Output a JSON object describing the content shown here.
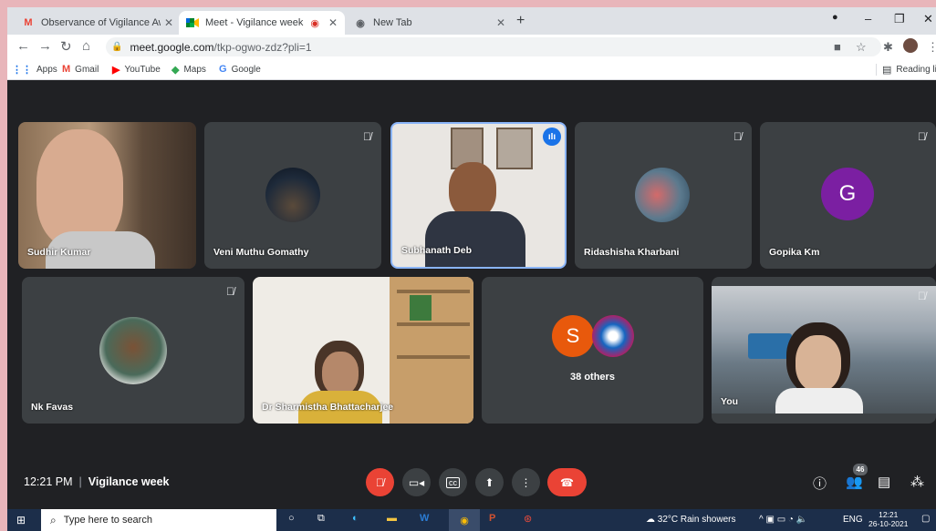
{
  "browser": {
    "tabs": [
      {
        "title": "Observance of Vigilance Awarene",
        "icon": "gmail-icon",
        "active": false
      },
      {
        "title": "Meet - Vigilance week",
        "icon": "meet-icon",
        "active": true
      },
      {
        "title": "New Tab",
        "icon": "chrome-icon",
        "active": false
      }
    ],
    "url_host": "meet.google.com",
    "url_path": "/tkp-ogwo-zdz?pli=1",
    "bookmarks": [
      "Apps",
      "Gmail",
      "YouTube",
      "Maps",
      "Google"
    ],
    "reading_list": "Reading list"
  },
  "meet": {
    "participants_row1": [
      {
        "name": "Sudhir Kumar",
        "muted": false,
        "kind": "video"
      },
      {
        "name": "Veni Muthu Gomathy",
        "muted": true,
        "kind": "avatar"
      },
      {
        "name": "Subhanath Deb",
        "muted": false,
        "kind": "video"
      },
      {
        "name": "Ridashisha Kharbani",
        "muted": true,
        "kind": "avatar"
      },
      {
        "name": "Gopika Km",
        "muted": true,
        "kind": "letter",
        "letter": "G"
      }
    ],
    "participants_row2": [
      {
        "name": "Nk Favas",
        "muted": true,
        "kind": "avatar"
      },
      {
        "name": "Dr Sharmistha Bhattacharjee",
        "muted": false,
        "kind": "video"
      },
      {
        "name": "38 others",
        "kind": "group",
        "letter": "S"
      },
      {
        "name": "You",
        "muted": true,
        "kind": "video"
      }
    ],
    "time": "12:21 PM",
    "meeting_title": "Vigilance week",
    "people_count": "46",
    "colors": {
      "red": "#ea4335",
      "tile": "#3c4043",
      "blue": "#1a73e8",
      "gopika": "#7b1fa2",
      "others_s": "#e8590c"
    }
  },
  "taskbar": {
    "search_placeholder": "Type here to search",
    "weather": "32°C  Rain showers",
    "lang": "ENG",
    "time": "12:21",
    "date": "26-10-2021"
  }
}
